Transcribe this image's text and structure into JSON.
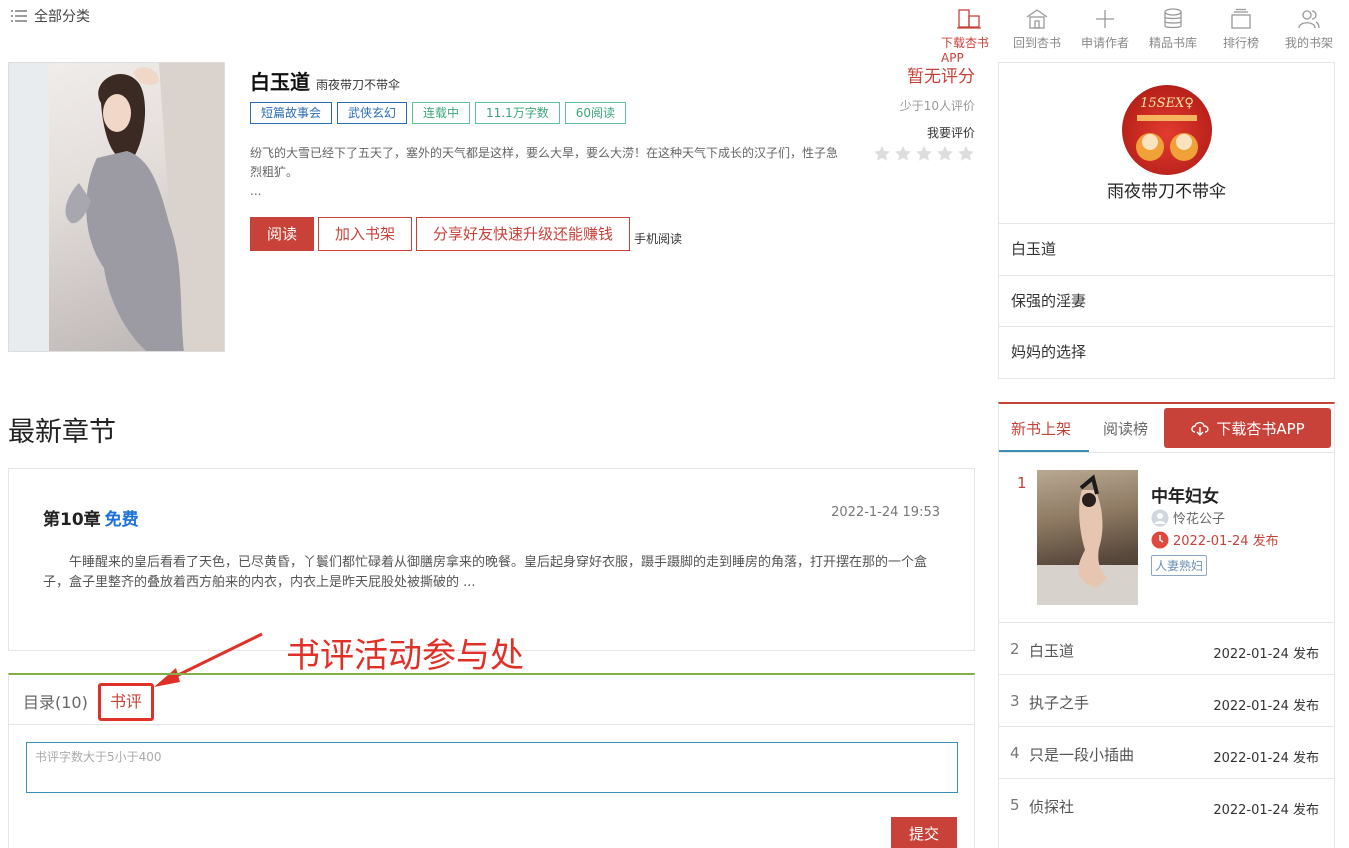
{
  "top": {
    "category_label": "全部分类",
    "nav": [
      {
        "label": "下载杏书APP",
        "icon": "download-app-icon",
        "active": true
      },
      {
        "label": "回到杏书",
        "icon": "home-icon",
        "active": false
      },
      {
        "label": "申请作者",
        "icon": "plus-icon",
        "active": false
      },
      {
        "label": "精品书库",
        "icon": "database-icon",
        "active": false
      },
      {
        "label": "排行榜",
        "icon": "ranking-icon",
        "active": false
      },
      {
        "label": "我的书架",
        "icon": "user-group-icon",
        "active": false
      }
    ]
  },
  "book": {
    "title": "白玉道",
    "author": "雨夜带刀不带伞",
    "tags": [
      "短篇故事会",
      "武侠玄幻",
      "连载中",
      "11.1万字数",
      "60阅读"
    ],
    "intro": "纷飞的大雪已经下了五天了，塞外的天气都是这样，要么大旱，要么大涝！在这种天气下成长的汉子们，性子急烈粗犷。",
    "intro_more": "...",
    "read_label": "阅读",
    "shelf_label": "加入书架",
    "share_label": "分享好友快速升级还能赚钱",
    "mobile_label": "手机阅读"
  },
  "rating": {
    "score_label": "暂无评分",
    "count_label": "少于10人评价",
    "mine_label": "我要评价",
    "stars_filled": 0,
    "stars_total": 5
  },
  "author_box": {
    "name": "雨夜带刀不带伞",
    "avatar_text": "15SEX♀",
    "books": [
      "白玉道",
      "保强的淫妻",
      "妈妈的选择"
    ]
  },
  "latest": {
    "heading": "最新章节",
    "chapter": "第10章",
    "free": "免费",
    "time": "2022-1-24 19:53",
    "text": "午睡醒来的皇后看看了天色，已尽黄昏，丫鬟们都忙碌着从御膳房拿来的晚餐。皇后起身穿好衣服，蹑手蹑脚的走到睡房的角落，打开摆在那的一个盒子，盒子里整齐的叠放着西方舶来的内衣，内衣上是昨天屁股处被撕破的 ..."
  },
  "annotation": {
    "text": "书评活动参与处"
  },
  "tabs": {
    "list_label": "目录(10)",
    "review_label": "书评",
    "review_placeholder": "书评字数大于5小于400",
    "submit_label": "提交"
  },
  "rank": {
    "tab_new": "新书上架",
    "tab_read": "阅读榜",
    "download_label": "下载杏书APP",
    "first": {
      "num": "1",
      "title": "中年妇女",
      "author": "怜花公子",
      "date": "2022-01-24 发布",
      "tag": "人妻熟妇"
    },
    "rows": [
      {
        "num": "2",
        "name": "白玉道",
        "date": "2022-01-24 发布"
      },
      {
        "num": "3",
        "name": "执子之手",
        "date": "2022-01-24 发布"
      },
      {
        "num": "4",
        "name": "只是一段小插曲",
        "date": "2022-01-24 发布"
      },
      {
        "num": "5",
        "name": "侦探社",
        "date": "2022-01-24 发布"
      }
    ]
  },
  "colors": {
    "accent": "#c9423a",
    "link_blue": "#1e73d8",
    "tag_blue": "#2a6db5",
    "tag_green": "#3aa77a",
    "annotation": "#e03128"
  }
}
